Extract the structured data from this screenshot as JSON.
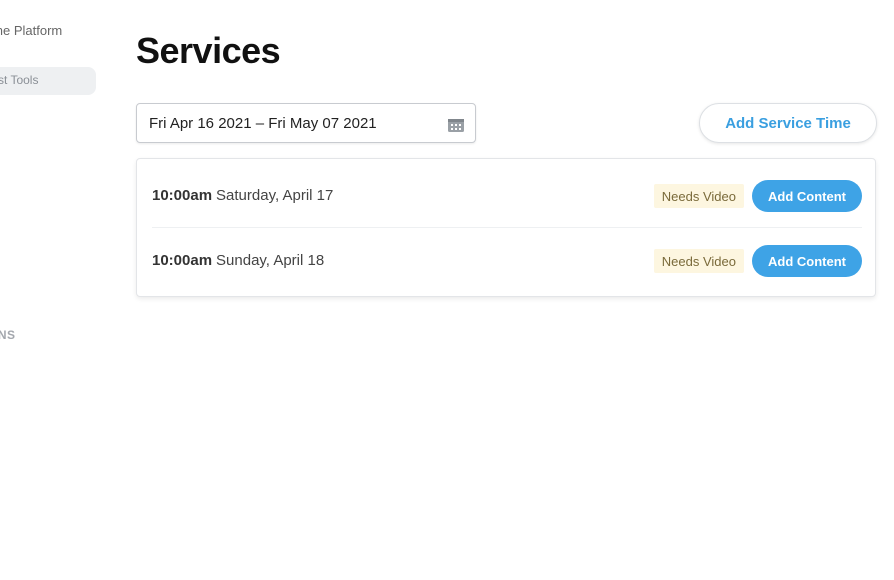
{
  "sidebar": {
    "platform_label": "line Platform",
    "tools_label": "st Tools",
    "section_label": "ONS"
  },
  "page": {
    "title": "Services"
  },
  "date_range": {
    "value": "Fri Apr 16 2021 – Fri May 07 2021",
    "icon": "calendar-icon"
  },
  "actions": {
    "add_service_time": "Add Service Time"
  },
  "services": [
    {
      "time": "10:00am",
      "date": "Saturday, April 17",
      "status": "Needs Video",
      "action": "Add Content"
    },
    {
      "time": "10:00am",
      "date": "Sunday, April 18",
      "status": "Needs Video",
      "action": "Add Content"
    }
  ],
  "colors": {
    "accent": "#3ea3e6",
    "badge_bg": "#fdf6e0",
    "badge_text": "#7a6a3a",
    "title": "#111111"
  }
}
